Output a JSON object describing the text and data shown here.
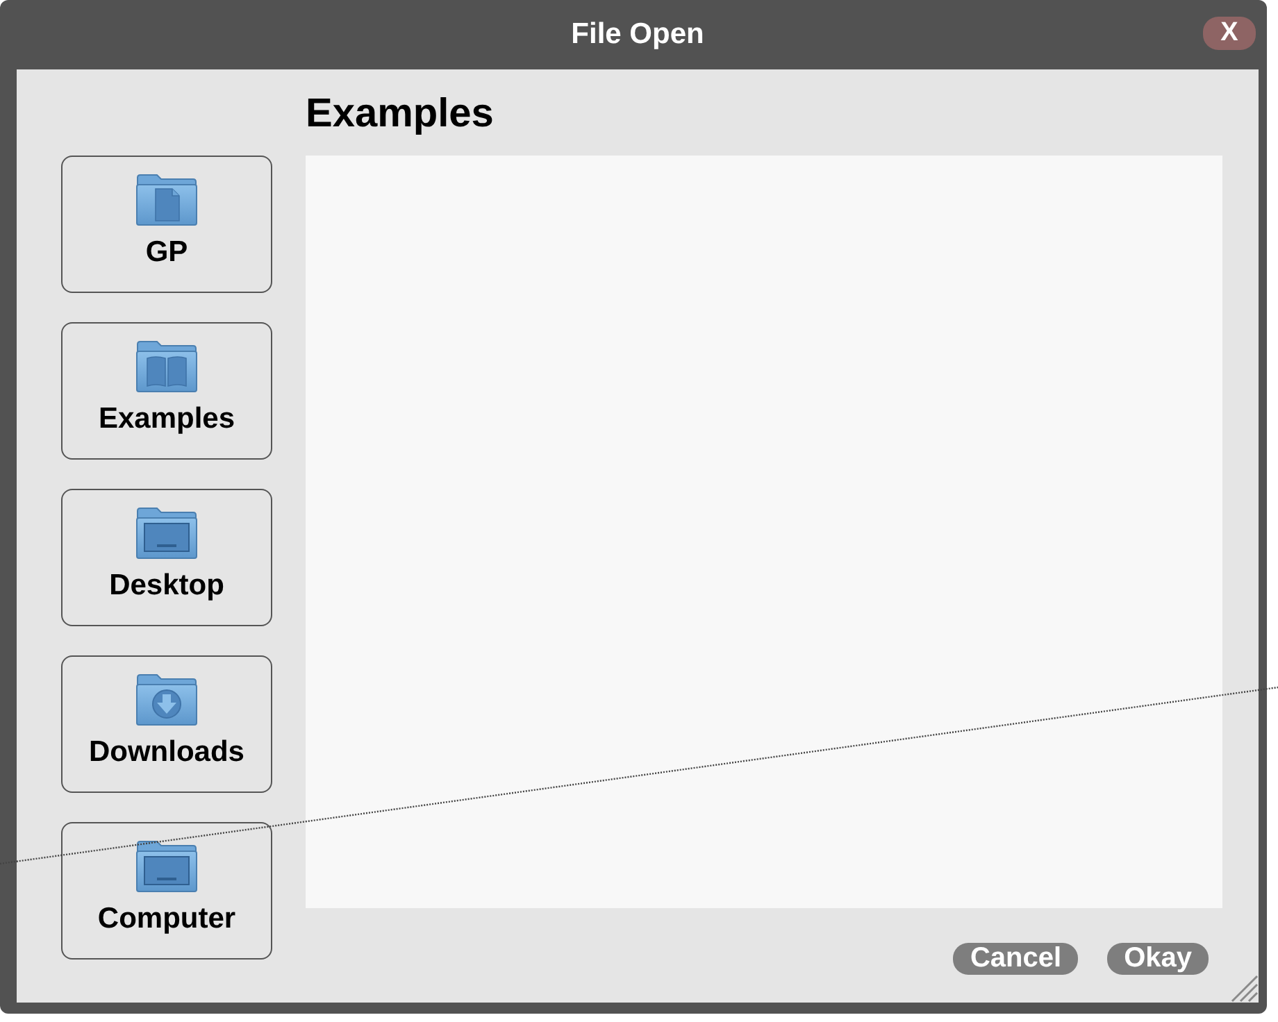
{
  "window": {
    "title": "File Open",
    "close_label": "X"
  },
  "sidebar": {
    "items": [
      {
        "label": "GP"
      },
      {
        "label": "Examples"
      },
      {
        "label": "Desktop"
      },
      {
        "label": "Downloads"
      },
      {
        "label": "Computer"
      }
    ]
  },
  "panel": {
    "title": "Examples"
  },
  "buttons": [
    {
      "label": "Cancel"
    },
    {
      "label": "Okay"
    }
  ]
}
